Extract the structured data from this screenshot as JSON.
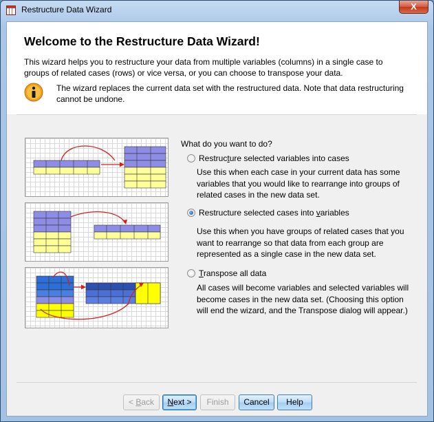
{
  "window": {
    "title": "Restructure Data Wizard",
    "close_glyph": "X"
  },
  "header": {
    "title": "Welcome to the Restructure Data Wizard!",
    "intro": "This wizard helps you to restructure your data from multiple variables (columns) in a single case to groups of related cases (rows) or vice versa, or you can choose to transpose your data.",
    "note": "The wizard replaces the current data set with the restructured data.  Note that data restructuring cannot be undone."
  },
  "question": "What do you want to do?",
  "options": [
    {
      "label_pre": "Restruc",
      "label_key": "t",
      "label_post": "ure selected variables into cases",
      "selected": false,
      "description": "Use this when each case in your current data has some variables that you would like to rearrange into groups of related cases in the new data set."
    },
    {
      "label_pre": "Restructure selected cases into ",
      "label_key": "v",
      "label_post": "ariables",
      "selected": true,
      "description": "Use this when you have groups of related cases that you want to rearrange so that data from each group are represented as a single case in the new data set."
    },
    {
      "label_pre": "",
      "label_key": "T",
      "label_post": "ranspose all data",
      "selected": false,
      "description": "All cases will become variables and selected variables will become cases in the new data set. (Choosing this option will end the wizard, and the Transpose dialog will appear.)"
    }
  ],
  "buttons": {
    "back": {
      "prefix": "< ",
      "key": "B",
      "rest": "ack",
      "enabled": false
    },
    "next": {
      "key": "N",
      "rest": "ext >",
      "enabled": true
    },
    "finish": {
      "label": "Finish",
      "enabled": false
    },
    "cancel": {
      "label": "Cancel",
      "enabled": true
    },
    "help": {
      "label": "Help",
      "enabled": true
    }
  },
  "colors": {
    "accent_blue": "#2d6fd6",
    "diagram_purple": "#8d8de6",
    "diagram_yellow": "#ffff99",
    "arrow_red": "#d62020"
  }
}
